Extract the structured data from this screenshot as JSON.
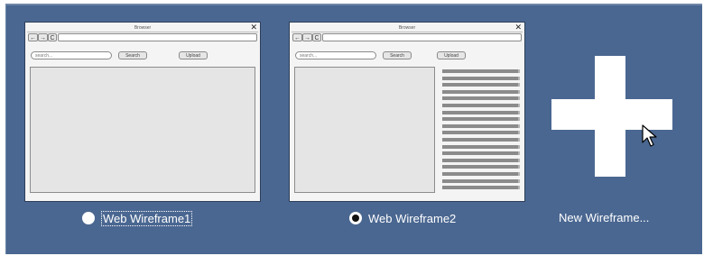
{
  "wireframes": [
    {
      "name": "Web Wireframe1",
      "layout": "single-pane",
      "selected": false,
      "focused": true,
      "preview": {
        "browser_title": "Browser",
        "nav_back": "←",
        "nav_forward": "→",
        "nav_refresh": "C",
        "close_glyph": "✕",
        "search_placeholder": "search...",
        "search_button": "Search",
        "upload_button": "Upload"
      }
    },
    {
      "name": "Web Wireframe2",
      "layout": "split-pane-list",
      "selected": true,
      "focused": false,
      "preview": {
        "browser_title": "Browser",
        "nav_back": "←",
        "nav_forward": "→",
        "nav_refresh": "C",
        "close_glyph": "✕",
        "search_placeholder": "search...",
        "search_button": "Search",
        "upload_button": "Upload"
      }
    }
  ],
  "new_wireframe": {
    "label": "New Wireframe...",
    "icon": "plus-icon"
  },
  "colors": {
    "panel_bg": "#4a6791",
    "text": "#ffffff",
    "preview_bg": "#f4f4f4",
    "content_bg": "#e5e5e5",
    "list_line": "#8b8b8b"
  }
}
